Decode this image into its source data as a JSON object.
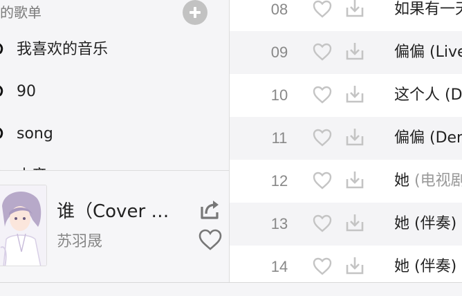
{
  "sidebar": {
    "section_title": "的歌单",
    "playlists": [
      {
        "label": "我喜欢的音乐"
      },
      {
        "label": "90"
      },
      {
        "label": "song"
      },
      {
        "label": "古音"
      }
    ]
  },
  "now_playing": {
    "title": "谁（Cover …",
    "artist": "苏羽晟"
  },
  "tracks": [
    {
      "num": "08",
      "title": "如果有一天",
      "sub": ""
    },
    {
      "num": "09",
      "title": "偏偏 (Live",
      "sub": ""
    },
    {
      "num": "10",
      "title": "这个人 (D",
      "sub": ""
    },
    {
      "num": "11",
      "title": "偏偏 (Dem",
      "sub": ""
    },
    {
      "num": "12",
      "title": "她 ",
      "sub": "(电视剧"
    },
    {
      "num": "13",
      "title": "她 (伴奏)",
      "sub": ""
    },
    {
      "num": "14",
      "title": "她 (伴奏)",
      "sub": ""
    }
  ],
  "colors": {
    "icon_gray": "#c4c4c4",
    "row_alt": "#f4f4f6",
    "row_white": "#ffffff"
  },
  "icons": {
    "add": "plus-circle-icon",
    "playlist": "playlist-icon",
    "share": "share-icon",
    "heart": "heart-icon",
    "download": "download-icon"
  }
}
